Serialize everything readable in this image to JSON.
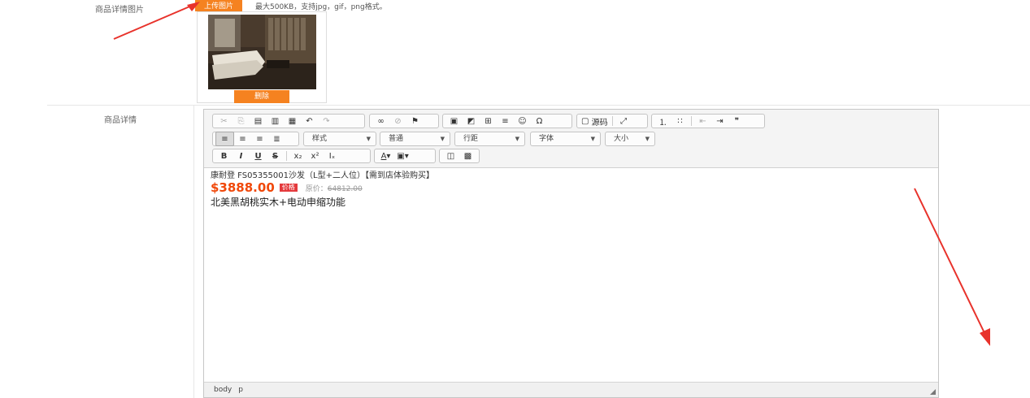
{
  "form": {
    "detail_images_label": "商品详情图片",
    "upload_button": "上传图片",
    "upload_hint": "最大500KB，支持jpg，gif，png格式。",
    "delete_button": "删除",
    "detail_label": "商品详情"
  },
  "editor": {
    "toolbar_row1": [
      "cut-icon",
      "copy-icon",
      "paste-icon",
      "paste-text-icon",
      "paste-word-icon",
      "undo-icon",
      "redo-icon",
      "link-icon",
      "unlink-icon",
      "anchor-icon",
      "image-icon",
      "flash-icon",
      "table-icon",
      "hr-icon",
      "smiley-icon",
      "special-char-icon",
      "maximize-icon",
      "numbered-list-icon",
      "bulleted-list-icon",
      "outdent-icon",
      "indent-icon",
      "blockquote-icon"
    ],
    "source_label": "源码",
    "combos": {
      "styles": "样式",
      "format": "普通",
      "line_height": "行距",
      "font": "字体",
      "size": "大小"
    },
    "toolbar_row3": {
      "bold": "B",
      "italic": "I",
      "underline": "U",
      "strike": "S"
    },
    "content": {
      "title": "康耐登 FS05355001沙发（L型+二人位）【需到店体验购买】",
      "price": "$3888.00",
      "price_badge": "价格",
      "original_price_label": "原价：",
      "original_price": "64812.00",
      "description": "北美黑胡桃实木+电动申缩功能"
    },
    "status_path": [
      "body",
      "p"
    ]
  },
  "colors": {
    "accent": "#f58220",
    "arrow": "#e8322b",
    "price": "#f0480a"
  }
}
